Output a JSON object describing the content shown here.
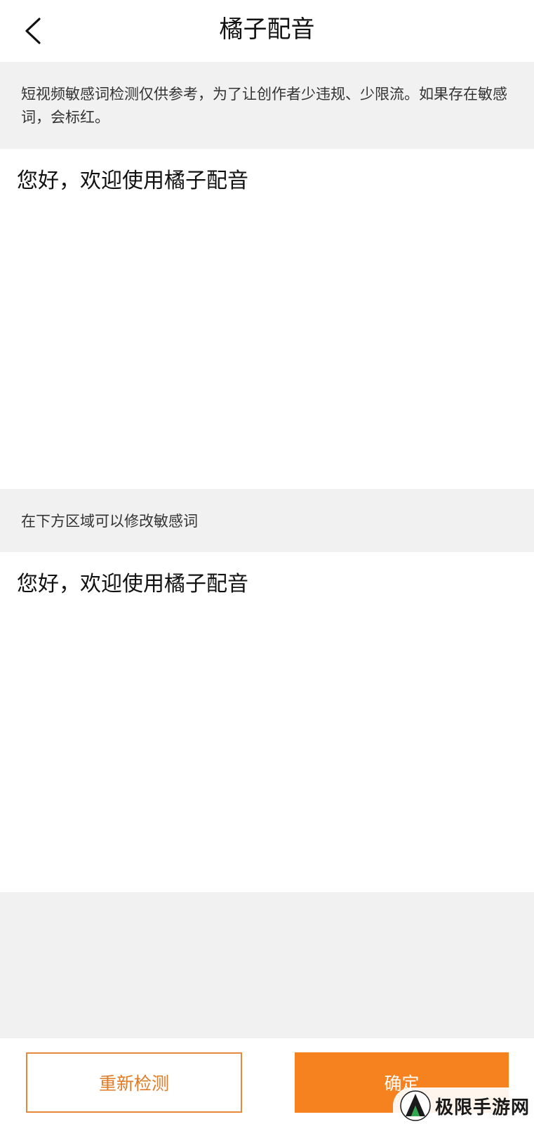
{
  "header": {
    "title": "橘子配音",
    "back_icon": "chevron-left-icon"
  },
  "notice": {
    "text": "短视频敏感词检测仅供参考，为了让创作者少违规、少限流。如果存在敏感词，会标红。"
  },
  "original": {
    "text": "您好，欢迎使用橘子配音"
  },
  "edit_section": {
    "label": "在下方区域可以修改敏感词",
    "text": "您好，欢迎使用橘子配音"
  },
  "footer": {
    "recheck_label": "重新检测",
    "confirm_label": "确定"
  },
  "watermark": {
    "text": "极限手游网"
  },
  "colors": {
    "accent": "#f5821f",
    "accent_text": "#e07a24",
    "panel_bg": "#f1f1f1"
  }
}
